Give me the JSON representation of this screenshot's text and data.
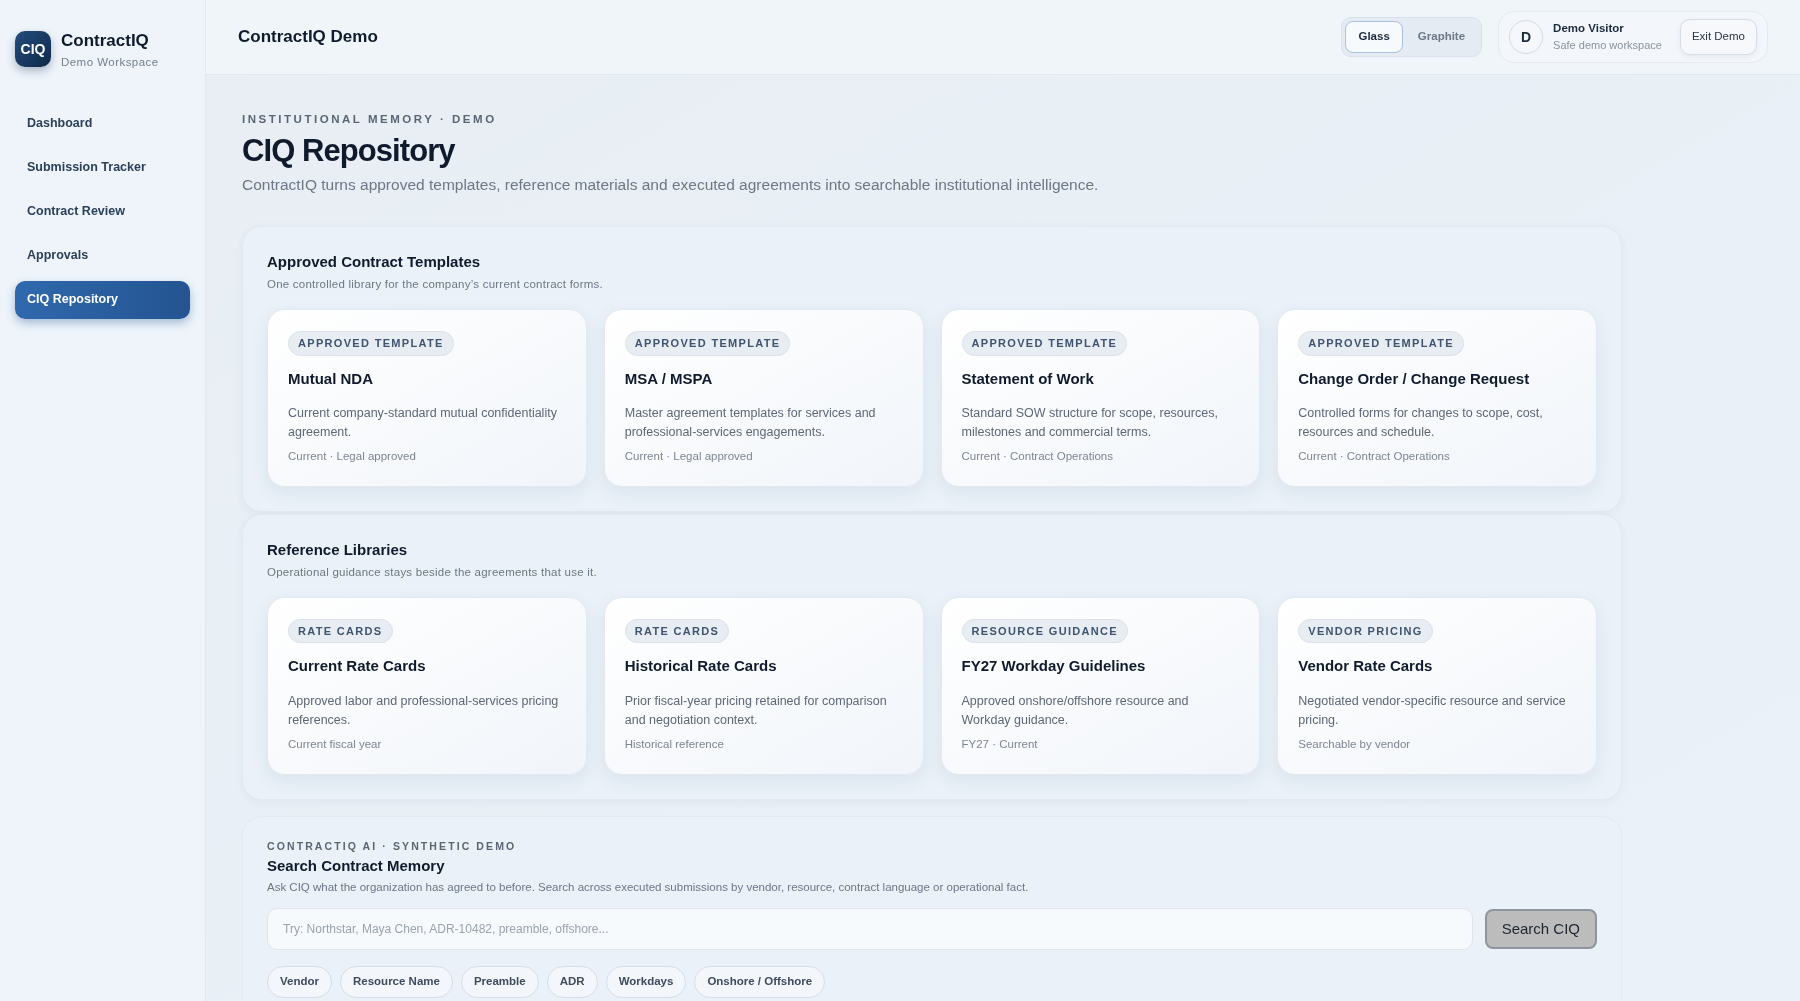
{
  "brand": {
    "logo": "CIQ",
    "name": "ContractIQ",
    "subtitle": "Demo Workspace"
  },
  "sidebar": {
    "items": [
      {
        "label": "Dashboard",
        "selected": false
      },
      {
        "label": "Submission Tracker",
        "selected": false
      },
      {
        "label": "Contract Review",
        "selected": false
      },
      {
        "label": "Approvals",
        "selected": false
      },
      {
        "label": "CIQ Repository",
        "selected": true
      }
    ]
  },
  "header": {
    "title": "ContractIQ Demo",
    "themes": [
      {
        "label": "Glass",
        "selected": true
      },
      {
        "label": "Graphite",
        "selected": false
      }
    ],
    "user": {
      "initial": "D",
      "name": "Demo Visitor",
      "subtitle": "Safe demo workspace"
    },
    "exit_button": "Exit Demo"
  },
  "page": {
    "eyebrow": "INSTITUTIONAL MEMORY · DEMO",
    "title": "CIQ Repository",
    "description": "ContractIQ turns approved templates, reference materials and executed agreements into searchable institutional intelligence."
  },
  "sections": [
    {
      "title": "Approved Contract Templates",
      "subtitle": "One controlled library for the company’s current contract forms.",
      "cards": [
        {
          "tag": "APPROVED TEMPLATE",
          "title": "Mutual NDA",
          "description": "Current company-standard mutual confidentiality agreement.",
          "meta": "Current · Legal approved"
        },
        {
          "tag": "APPROVED TEMPLATE",
          "title": "MSA / MSPA",
          "description": "Master agreement templates for services and professional-services engagements.",
          "meta": "Current · Legal approved"
        },
        {
          "tag": "APPROVED TEMPLATE",
          "title": "Statement of Work",
          "description": "Standard SOW structure for scope, resources, milestones and commercial terms.",
          "meta": "Current · Contract Operations"
        },
        {
          "tag": "APPROVED TEMPLATE",
          "title": "Change Order / Change Request",
          "description": "Controlled forms for changes to scope, cost, resources and schedule.",
          "meta": "Current · Contract Operations"
        }
      ]
    },
    {
      "title": "Reference Libraries",
      "subtitle": "Operational guidance stays beside the agreements that use it.",
      "cards": [
        {
          "tag": "RATE CARDS",
          "title": "Current Rate Cards",
          "description": "Approved labor and professional-services pricing references.",
          "meta": "Current fiscal year"
        },
        {
          "tag": "RATE CARDS",
          "title": "Historical Rate Cards",
          "description": "Prior fiscal-year pricing retained for comparison and negotiation context.",
          "meta": "Historical reference"
        },
        {
          "tag": "RESOURCE GUIDANCE",
          "title": "FY27 Workday Guidelines",
          "description": "Approved onshore/offshore resource and Workday guidance.",
          "meta": "FY27 · Current"
        },
        {
          "tag": "VENDOR PRICING",
          "title": "Vendor Rate Cards",
          "description": "Negotiated vendor-specific resource and service pricing.",
          "meta": "Searchable by vendor"
        }
      ]
    }
  ],
  "search": {
    "eyebrow": "CONTRACTIQ AI · SYNTHETIC DEMO",
    "title": "Search Contract Memory",
    "description": "Ask CIQ what the organization has agreed to before. Search across executed submissions by vendor, resource, contract language or operational fact.",
    "placeholder": "Try: Northstar, Maya Chen, ADR-10482, preamble, offshore...",
    "button": "Search CIQ",
    "chips": [
      "Vendor",
      "Resource Name",
      "Preamble",
      "ADR",
      "Workdays",
      "Onshore / Offshore"
    ]
  }
}
